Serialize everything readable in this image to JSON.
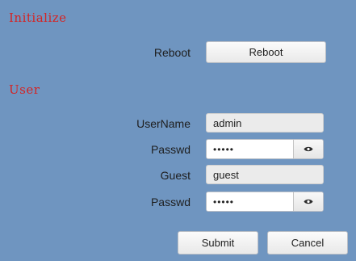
{
  "initialize": {
    "title": "Initialize",
    "reboot_label": "Reboot",
    "reboot_button": "Reboot"
  },
  "user": {
    "title": "User",
    "username_label": "UserName",
    "username_value": "admin",
    "passwd_label": "Passwd",
    "passwd_value": "12345",
    "guest_label": "Guest",
    "guest_value": "guest",
    "guest_passwd_label": "Passwd",
    "guest_passwd_value": "12345"
  },
  "actions": {
    "submit": "Submit",
    "cancel": "Cancel"
  },
  "icons": {
    "show_password": "eye-icon"
  },
  "colors": {
    "background": "#6f95c0",
    "section_title": "#d42424"
  }
}
